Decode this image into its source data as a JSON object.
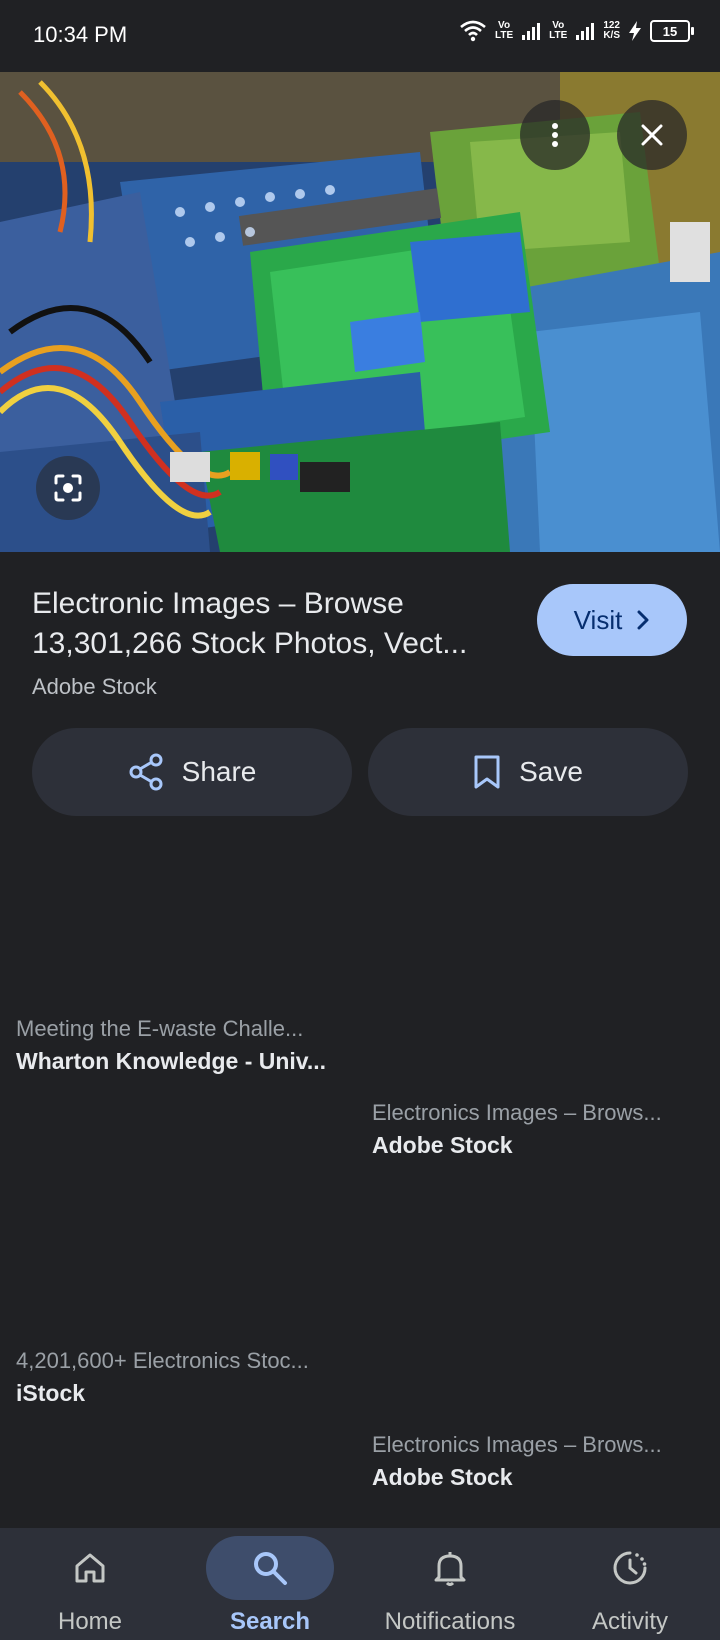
{
  "status_bar": {
    "time": "10:34 PM",
    "vo1_top": "Vo",
    "vo1_bottom": "LTE",
    "vo2_top": "Vo",
    "vo2_bottom": "LTE",
    "speed_top": "122",
    "speed_bottom": "K/S",
    "battery": "15"
  },
  "hero": {
    "more_icon": "more-vert-icon",
    "close_icon": "close-icon",
    "lens_icon": "google-lens-icon"
  },
  "detail": {
    "title_line1": "Electronic Images – Browse",
    "title_line2": "13,301,266 Stock Photos, Vect...",
    "source": "Adobe Stock",
    "visit_label": "Visit",
    "share_label": "Share",
    "save_label": "Save"
  },
  "results": [
    {
      "title": "Meeting the E-waste Challe...",
      "source": "Wharton Knowledge - Univ..."
    },
    {
      "title": "Electronics Images – Brows...",
      "source": "Adobe Stock"
    },
    {
      "title": "4,201,600+ Electronics Stoc...",
      "source": "iStock"
    },
    {
      "title": "Electronics Images – Brows...",
      "source": "Adobe Stock"
    }
  ],
  "bottom_nav": [
    {
      "label": "Home",
      "icon": "home-icon"
    },
    {
      "label": "Search",
      "icon": "search-icon",
      "active": true
    },
    {
      "label": "Notifications",
      "icon": "bell-icon"
    },
    {
      "label": "Activity",
      "icon": "activity-icon"
    }
  ],
  "colors": {
    "background": "#202124",
    "accent": "#a8c7fa",
    "button_surface": "#2d3039"
  }
}
